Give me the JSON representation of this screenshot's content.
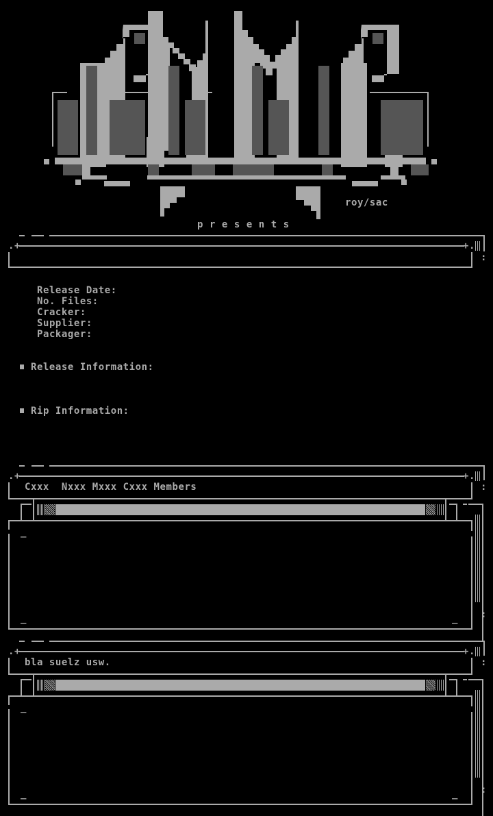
{
  "logo": {
    "letters": "CNMC",
    "artist": "roy/sac",
    "tagline": "p r e s e n t s"
  },
  "release_header": {
    "title": ""
  },
  "info_fields": [
    {
      "label": "Release Date:",
      "value": ""
    },
    {
      "label": "No. Files:",
      "value": ""
    },
    {
      "label": "Cracker:",
      "value": ""
    },
    {
      "label": "Supplier:",
      "value": ""
    },
    {
      "label": "Packager:",
      "value": ""
    }
  ],
  "sections": [
    {
      "bullet": "▪",
      "title": "Release Information:",
      "body": ""
    },
    {
      "bullet": "▪",
      "title": "Rip Information:",
      "body": ""
    }
  ],
  "panels": [
    {
      "title": "Cxxx  Nxxx Mxxx Cxxx Members",
      "body": ""
    },
    {
      "title": "bla suelz usw.",
      "body": ""
    }
  ],
  "colors": {
    "background": "#000000",
    "foreground": "#aaaaaa"
  }
}
